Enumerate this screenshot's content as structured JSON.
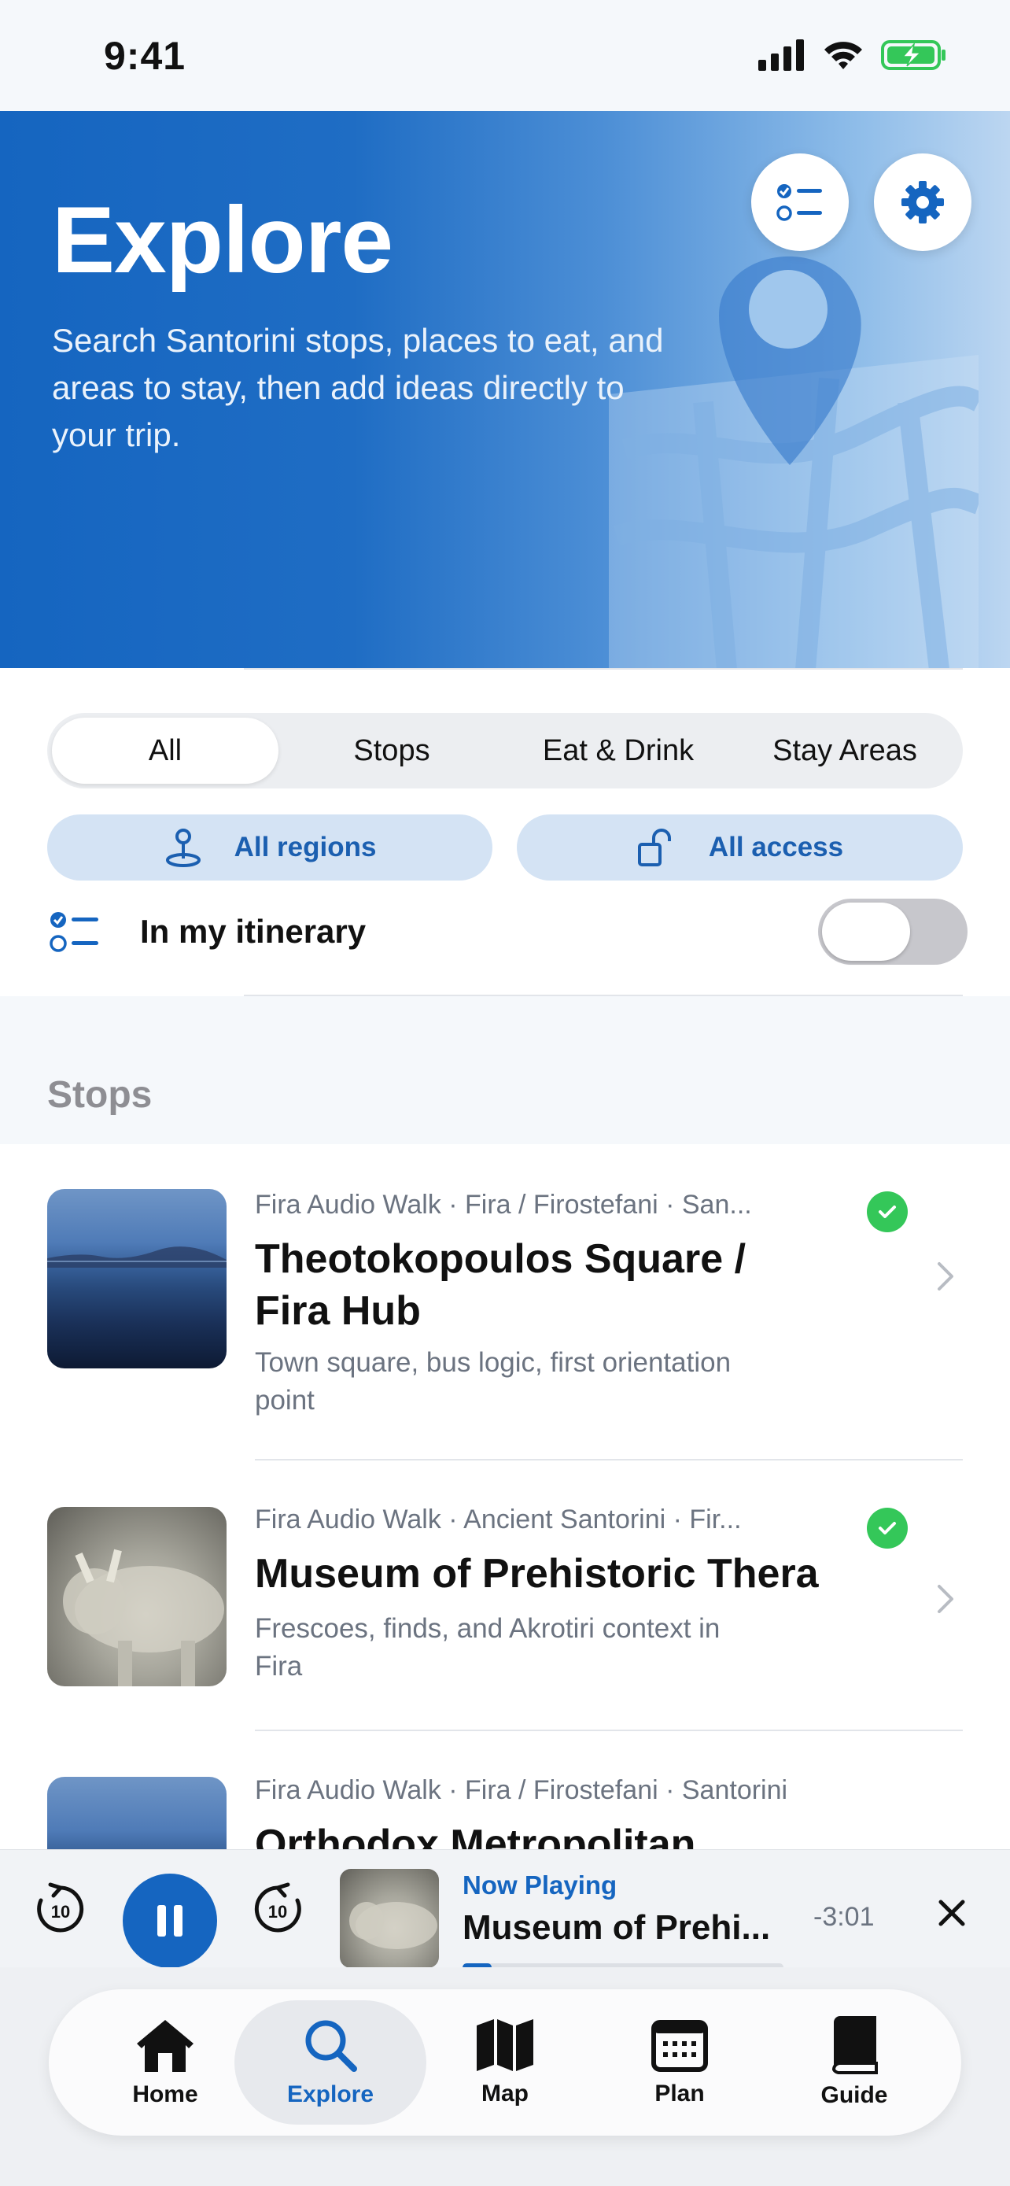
{
  "status_bar": {
    "time": "9:41"
  },
  "hero": {
    "title": "Explore",
    "subtitle": "Search Santorini stops, places to eat, and areas to stay, then add ideas directly to your trip."
  },
  "segments": [
    {
      "label": "All",
      "active": true
    },
    {
      "label": "Stops",
      "active": false
    },
    {
      "label": "Eat & Drink",
      "active": false
    },
    {
      "label": "Stay Areas",
      "active": false
    }
  ],
  "filters": {
    "regions_label": "All regions",
    "access_label": "All access"
  },
  "itinerary_toggle": {
    "label": "In my itinerary",
    "on": false
  },
  "section": {
    "title": "Stops"
  },
  "stops": [
    {
      "meta": "Fira Audio Walk · Fira / Firostefani · San...",
      "title": "Theotokopoulos Square / Fira Hub",
      "description": "Town square, bus logic, first orientation point",
      "in_itinerary": true
    },
    {
      "meta": "Fira Audio Walk · Ancient Santorini · Fir...",
      "title": "Museum of Prehistoric Thera",
      "description": "Frescoes, finds, and Akrotiri context in Fira",
      "in_itinerary": true
    },
    {
      "meta": "Fira Audio Walk · Fira / Firostefani · Santorini",
      "title": "Orthodox Metropolitan",
      "description": "",
      "in_itinerary": false
    }
  ],
  "player": {
    "label": "Now Playing",
    "title": "Museum of Prehi...",
    "time_remaining": "-3:01",
    "progress": 0.09
  },
  "tabs": [
    {
      "label": "Home",
      "icon": "home-icon",
      "active": false
    },
    {
      "label": "Explore",
      "icon": "search-icon",
      "active": true
    },
    {
      "label": "Map",
      "icon": "map-icon",
      "active": false
    },
    {
      "label": "Plan",
      "icon": "calendar-icon",
      "active": false
    },
    {
      "label": "Guide",
      "icon": "book-icon",
      "active": false
    }
  ],
  "colors": {
    "accent": "#1565c0",
    "pill_bg": "#d4e3f4",
    "check_green": "#34c759"
  }
}
